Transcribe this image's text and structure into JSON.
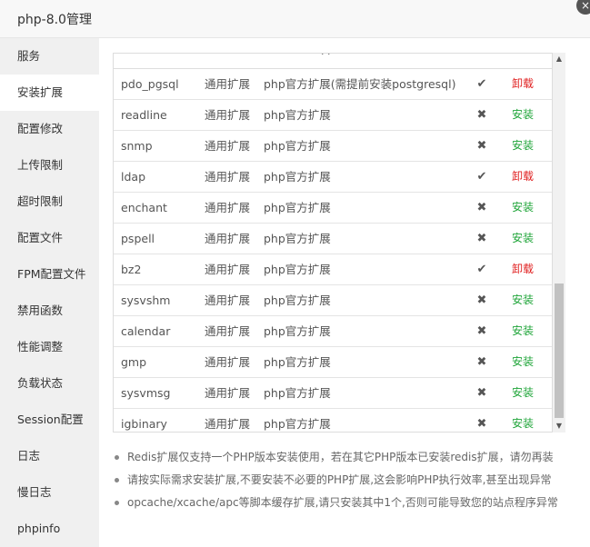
{
  "window": {
    "title": "php-8.0管理",
    "close_icon": "×"
  },
  "sidebar": {
    "items": [
      {
        "label": "服务",
        "active": false
      },
      {
        "label": "安装扩展",
        "active": true
      },
      {
        "label": "配置修改",
        "active": false
      },
      {
        "label": "上传限制",
        "active": false
      },
      {
        "label": "超时限制",
        "active": false
      },
      {
        "label": "配置文件",
        "active": false
      },
      {
        "label": "FPM配置文件",
        "active": false
      },
      {
        "label": "禁用函数",
        "active": false
      },
      {
        "label": "性能调整",
        "active": false
      },
      {
        "label": "负载状态",
        "active": false
      },
      {
        "label": "Session配置",
        "active": false
      },
      {
        "label": "日志",
        "active": false
      },
      {
        "label": "慢日志",
        "active": false
      },
      {
        "label": "phpinfo",
        "active": false
      }
    ]
  },
  "table": {
    "partial_top_text": "· ·",
    "rows": [
      {
        "name": "pdo_pgsql",
        "type": "通用扩展",
        "desc": "php官方扩展(需提前安装postgresql)",
        "installed": true,
        "action": "卸载"
      },
      {
        "name": "readline",
        "type": "通用扩展",
        "desc": "php官方扩展",
        "installed": false,
        "action": "安装"
      },
      {
        "name": "snmp",
        "type": "通用扩展",
        "desc": "php官方扩展",
        "installed": false,
        "action": "安装"
      },
      {
        "name": "ldap",
        "type": "通用扩展",
        "desc": "php官方扩展",
        "installed": true,
        "action": "卸载"
      },
      {
        "name": "enchant",
        "type": "通用扩展",
        "desc": "php官方扩展",
        "installed": false,
        "action": "安装"
      },
      {
        "name": "pspell",
        "type": "通用扩展",
        "desc": "php官方扩展",
        "installed": false,
        "action": "安装"
      },
      {
        "name": "bz2",
        "type": "通用扩展",
        "desc": "php官方扩展",
        "installed": true,
        "action": "卸载"
      },
      {
        "name": "sysvshm",
        "type": "通用扩展",
        "desc": "php官方扩展",
        "installed": false,
        "action": "安装"
      },
      {
        "name": "calendar",
        "type": "通用扩展",
        "desc": "php官方扩展",
        "installed": false,
        "action": "安装"
      },
      {
        "name": "gmp",
        "type": "通用扩展",
        "desc": "php官方扩展",
        "installed": false,
        "action": "安装"
      },
      {
        "name": "sysvmsg",
        "type": "通用扩展",
        "desc": "php官方扩展",
        "installed": false,
        "action": "安装"
      },
      {
        "name": "igbinary",
        "type": "通用扩展",
        "desc": "php官方扩展",
        "installed": false,
        "action": "安装"
      }
    ],
    "installed_icon": "✔",
    "not_installed_icon": "✖"
  },
  "notes": [
    "Redis扩展仅支持一个PHP版本安装使用，若在其它PHP版本已安装redis扩展，请勿再装",
    "请按实际需求安装扩展,不要安装不必要的PHP扩展,这会影响PHP执行效率,甚至出现异常",
    "opcache/xcache/apc等脚本缓存扩展,请只安装其中1个,否则可能导致您的站点程序异常"
  ],
  "scrollbar": {
    "up_icon": "▲",
    "down_icon": "▼",
    "position_fraction": 0.74
  }
}
